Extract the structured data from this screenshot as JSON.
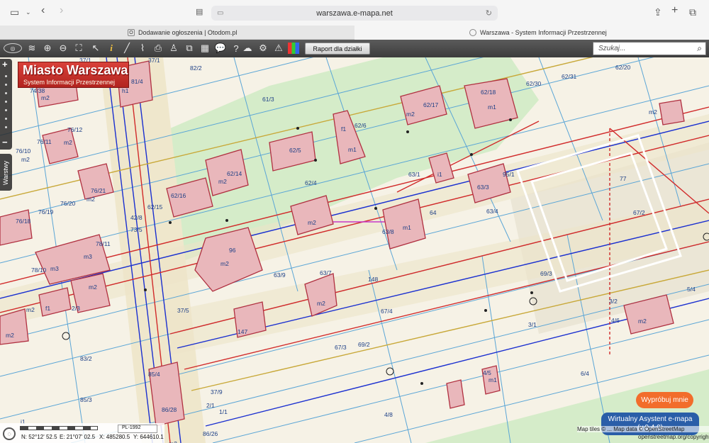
{
  "browser": {
    "url": "warszawa.e-mapa.net",
    "tabs": [
      {
        "title": "Dodawanie ogłoszenia | Otodom.pl",
        "favicon": "O"
      },
      {
        "title": "Warszawa - System Informacji Przestrzennej",
        "favicon": "map"
      }
    ]
  },
  "toolbar": {
    "raport_label": "Raport dla działki",
    "search_placeholder": "Szukaj..."
  },
  "logo": {
    "title": "Miasto Warszawa",
    "subtitle": "System Informacji Przestrzennej"
  },
  "side_panel": {
    "layers_label": "Warstwy"
  },
  "map_labels": [
    "82/2",
    "81/4",
    "37/1",
    "37/1",
    "h1",
    "74/38",
    "m2",
    "61/3",
    "62/31",
    "62/20",
    "62/30",
    "62/18",
    "m1",
    "62/17",
    "m2",
    "m2",
    "76/12",
    "m2",
    "76/11",
    "76/10",
    "m2",
    "62/6",
    "f1",
    "m1",
    "62/5",
    "62/4",
    "63/1",
    "i1",
    "95/1",
    "77",
    "62/14",
    "m2",
    "62/16",
    "76/21",
    "m2",
    "76/19",
    "76/20",
    "76/18",
    "62/15",
    "42/8",
    "73/5",
    "63/3",
    "63/4",
    "64",
    "67/2",
    "m2",
    "m1",
    "63/8",
    "78/11",
    "96",
    "m2",
    "m3",
    "78/10",
    "m3",
    "63/9",
    "63/7",
    "148",
    "69/3",
    "m2",
    "m2",
    "f1",
    "2/3",
    "m2",
    "67/4",
    "3/2",
    "37/5",
    "147",
    "3/1",
    "4/6",
    "m2",
    "5/4",
    "m2",
    "83/2",
    "67/3",
    "69/2",
    "85/4",
    "4/5",
    "m1",
    "6/4",
    "85/3",
    "37/9",
    "m2",
    "86/28",
    "4/8",
    "2/1",
    "i1",
    "86/26",
    "1/1"
  ],
  "controls": {
    "try_button": "Wypróbuj mnie",
    "assistant_line1": "Wirtualny Asystent e-mapa",
    "assistant_line2": "(v.0.4.0)"
  },
  "status": {
    "projection": "PL-1992",
    "n_label": "N: 52°12' 52.5",
    "e_label": "E: 21°07' 02.5",
    "x_label": "X: 485280.5",
    "y_label": "Y: 644610.1"
  },
  "attribution": {
    "line1": "Map tiles © ... Map data © OpenStreetMap",
    "line2": "openstreetmap.org/copyright"
  }
}
